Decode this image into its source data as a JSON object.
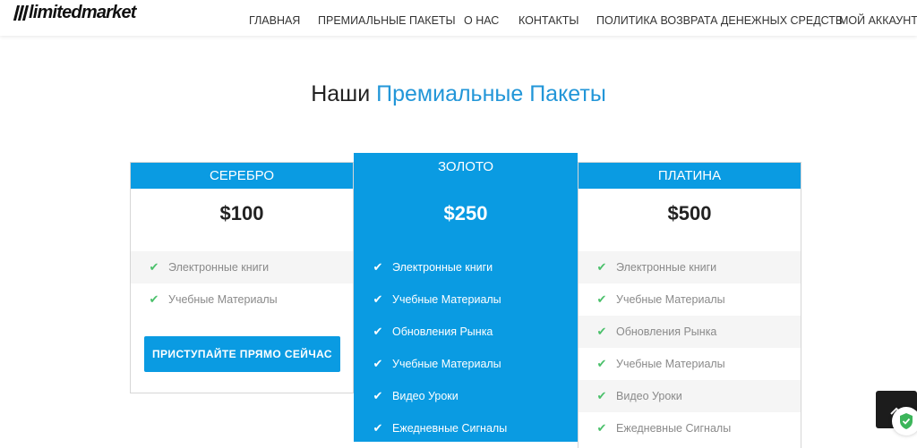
{
  "brand": {
    "logo_text": "limitedmarket"
  },
  "nav": {
    "items": [
      {
        "label": "ГЛАВНАЯ"
      },
      {
        "label": "ПРЕМИАЛЬНЫЕ ПАКЕТЫ"
      },
      {
        "label": "О НАС"
      },
      {
        "label": "КОНТАКТЫ"
      },
      {
        "label": "ПОЛИТИКА ВОЗВРАТА ДЕНЕЖНЫХ СРЕДСТВ"
      },
      {
        "label": "МОЙ АККАУНТ"
      }
    ]
  },
  "section": {
    "title_plain": "Наши",
    "title_accent": "Премиальные Пакеты"
  },
  "plans": [
    {
      "name": "СЕРЕБРО",
      "price": "$100",
      "features": [
        "Электронные книги",
        "Учебные Материалы"
      ],
      "button_label": "ПРИСТУПАЙТЕ ПРЯМО СЕЙЧАС"
    },
    {
      "name": "ЗОЛОТО",
      "price": "$250",
      "features": [
        "Электронные книги",
        "Учебные Материалы",
        "Обновления Рынка",
        "Учебные Материалы",
        "Видео Уроки",
        "Ежедневные Сигналы"
      ]
    },
    {
      "name": "ПЛАТИНА",
      "price": "$500",
      "features": [
        "Электронные книги",
        "Учебные Материалы",
        "Обновления Рынка",
        "Учебные Материалы",
        "Видео Уроки",
        "Ежедневные Сигналы"
      ]
    }
  ],
  "colors": {
    "accent": "#0a9be2",
    "title_accent": "#2296d8",
    "check_green": "#4ac06a"
  },
  "icons": {
    "feature": "check-icon",
    "scroll": "chevron-up-icon",
    "badge": "shield-check-icon"
  }
}
